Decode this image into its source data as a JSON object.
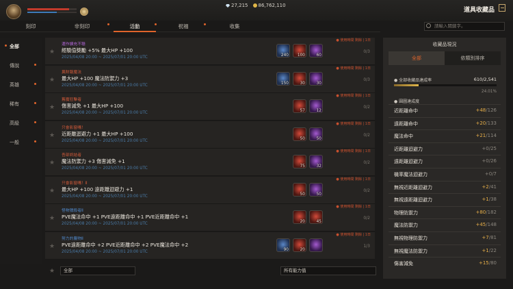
{
  "currency": {
    "gems": "27,215",
    "gold": "86,762,110"
  },
  "title": "道具收藏品",
  "player": {
    "hp_fraction": 0.85,
    "mp_fraction": 0.6
  },
  "tabs": [
    {
      "label": "刻印"
    },
    {
      "label": "非刻印"
    },
    {
      "label": "活動"
    },
    {
      "label": "祝福"
    },
    {
      "label": "收集"
    }
  ],
  "search": {
    "placeholder": "請輸入關鍵字。"
  },
  "sidebar": [
    {
      "label": "全部"
    },
    {
      "label": "傳說"
    },
    {
      "label": "英雄"
    },
    {
      "label": "稀有"
    },
    {
      "label": "高級"
    },
    {
      "label": "一般"
    }
  ],
  "entries": [
    {
      "cat": "運作擴充不穩",
      "cat_color": "#b066d6",
      "effect": "經驗值獎勵 +5% 最大HP +100",
      "date": "2025/04/08 20:00 ~ 2025/07/01 20:00 UTC",
      "reg": "● 使用時間 剩餘 | 1日",
      "items": [
        {
          "c": "blue",
          "n": "240"
        },
        {
          "c": "red",
          "n": "100"
        },
        {
          "c": "purple",
          "n": "60"
        }
      ],
      "count": "0/3"
    },
    {
      "cat": "異財報魔法",
      "cat_color": "#d05a3a",
      "effect": "最大HP +100 魔法防禦力 +3",
      "date": "2025/04/08 20:00 ~ 2025/07/01 20:00 UTC",
      "reg": "● 使用時間 剩餘 | 1日",
      "items": [
        {
          "c": "blue",
          "n": "150"
        },
        {
          "c": "red",
          "n": "30"
        },
        {
          "c": "purple",
          "n": "30"
        }
      ],
      "count": "0/3"
    },
    {
      "cat": "舊魔狂擊者",
      "cat_color": "#d05a3a",
      "effect": "傷害減免 +1 最大HP +100",
      "date": "2025/04/08 20:00 ~ 2025/07/01 20:00 UTC",
      "reg": "● 使用時間 剩餘 | 1日",
      "items": [
        {
          "c": "red",
          "n": "57"
        },
        {
          "c": "purple",
          "n": "12"
        }
      ],
      "count": "0/2"
    },
    {
      "cat": "只會影窗嘴！",
      "cat_color": "#d05a3a",
      "effect": "近距離迴避力 +1 最大HP +100",
      "date": "2025/04/08 20:00 ~ 2025/07/01 20:00 UTC",
      "reg": "● 使用時間 剩餘 | 1日",
      "items": [
        {
          "c": "red",
          "n": "50"
        },
        {
          "c": "purple",
          "n": "50"
        }
      ],
      "count": "0/2"
    },
    {
      "cat": "吾部終結者",
      "cat_color": "#d05a3a",
      "effect": "魔法防禦力 +3 傷害減免 +1",
      "date": "2025/04/08 20:00 ~ 2025/07/01 20:00 UTC",
      "reg": "● 使用時間 剩餘 | 1日",
      "items": [
        {
          "c": "red",
          "n": "75"
        },
        {
          "c": "purple",
          "n": "32"
        }
      ],
      "count": "0/2"
    },
    {
      "cat": "只會影窗嘴！Ⅱ",
      "cat_color": "#d05a3a",
      "effect": "最大HP +100 遠距離迴避力 +1",
      "date": "2025/04/08 20:00 ~ 2025/07/01 20:00 UTC",
      "reg": "● 使用時間 剩餘 | 1日",
      "items": [
        {
          "c": "red",
          "n": "50"
        },
        {
          "c": "purple",
          "n": "50"
        }
      ],
      "count": "0/2"
    },
    {
      "cat": "怪物獵殺者Ⅱ",
      "cat_color": "#4f86c6",
      "effect": "PVE魔法命中 +1 PVE遠距離命中 +1 PVE近距離命中 +1",
      "date": "2025/04/08 20:00 ~ 2025/07/01 20:00 UTC",
      "reg": "● 使用時間 剩餘 | 1日",
      "items": [
        {
          "c": "red",
          "n": "20"
        },
        {
          "c": "red",
          "n": "45"
        }
      ],
      "count": "0/2"
    },
    {
      "cat": "努力的農物Ⅱ",
      "cat_color": "#4f86c6",
      "effect": "PVE遠距離命中 +2 PVE近距離命中 +2 PVE魔法命中 +2",
      "date": "2025/04/08 20:00 ~ 2025/07/01 20:00 UTC",
      "reg": "● 使用時間 剩餘 | 1日",
      "items": [
        {
          "c": "blue",
          "n": "90"
        },
        {
          "c": "red",
          "n": "20"
        },
        {
          "c": "purple",
          "n": ""
        }
      ],
      "count": "1/3"
    }
  ],
  "filters": {
    "left": "全部",
    "right": "所有能力值"
  },
  "panel": {
    "title": "收藏品現況",
    "tabs": [
      {
        "label": "全部"
      },
      {
        "label": "依類別排序"
      }
    ],
    "progress_label": "● 全部收藏品達成率",
    "progress_value": "610/2,541",
    "progress_fraction": 0.2401,
    "progress_pct": "24.01%",
    "stat_header": "● 圓圖達成度",
    "stats": [
      {
        "name": "近距離命中",
        "gain": "+48",
        "total": "/126"
      },
      {
        "name": "遠距離命中",
        "gain": "+20",
        "total": "/133"
      },
      {
        "name": "魔法命中",
        "gain": "+21",
        "total": "/114"
      },
      {
        "name": "近距離迴避力",
        "gain": "+0",
        "total": "/25"
      },
      {
        "name": "遠距離迴避力",
        "gain": "+0",
        "total": "/26"
      },
      {
        "name": "機率魔法迴避力",
        "gain": "+0",
        "total": "/7"
      },
      {
        "name": "無視近距離迴避力",
        "gain": "+2",
        "total": "/41"
      },
      {
        "name": "無視遠距離迴避力",
        "gain": "+1",
        "total": "/38"
      },
      {
        "name": "物理防禦力",
        "gain": "+80",
        "total": "/182"
      },
      {
        "name": "魔法防禦力",
        "gain": "+45",
        "total": "/148"
      },
      {
        "name": "無視物理防禦力",
        "gain": "+7",
        "total": "/81"
      },
      {
        "name": "無視魔法防禦力",
        "gain": "+1",
        "total": "/22"
      },
      {
        "name": "傷害減免",
        "gain": "+15",
        "total": "/80"
      }
    ]
  }
}
